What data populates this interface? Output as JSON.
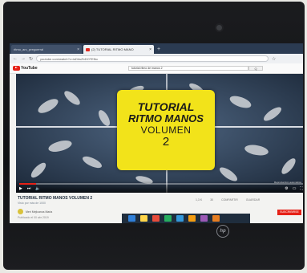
{
  "browser": {
    "tabs": [
      {
        "label": "ritmo_arc_preguerral"
      },
      {
        "label": "(2) TUTORIAL RITMO MANO"
      }
    ],
    "address": "youtube.com/watch?v=isDhsZbDOTEfhc"
  },
  "youtube": {
    "logo_text": "YouTube",
    "search_value": "tutorial ritmo de manos 2",
    "search_button": "Q"
  },
  "video": {
    "card": {
      "line1": "TUTORIAL",
      "line2": "RITMO MANOS",
      "line3": "VOLUMEN",
      "line4": "2"
    },
    "progress": 0.06,
    "title": "TUTORIAL RITMO MANOS VOLUMEN 2",
    "meta": "Visto por más de 1000",
    "actions": [
      "1,3 K",
      "30",
      "COMPARTIR",
      "GUARDAR"
    ],
    "channel": "Meri Mejicanos Maria",
    "publish": "Publicado el 00 abr 2019",
    "subscribe": "SUSCRIBIRSE",
    "autoplay": "Reproducción automática"
  },
  "taskbar_colors": [
    "#2f7fd8",
    "#ffd54a",
    "#e74c3c",
    "#27ae60",
    "#3498db",
    "#f39c12",
    "#9b59b6",
    "#e67e22"
  ],
  "laptop_brand": "hp"
}
